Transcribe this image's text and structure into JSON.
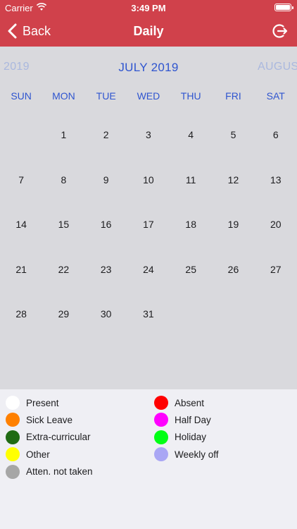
{
  "status_bar": {
    "carrier": "Carrier",
    "time": "3:49 PM",
    "battery_level": 1.0
  },
  "nav": {
    "back_label": "Back",
    "title": "Daily",
    "logout_icon": "logout-icon"
  },
  "calendar": {
    "prev_month": "2019",
    "current_month": "JULY 2019",
    "next_month": "AUGUST",
    "weekdays": [
      "SUN",
      "MON",
      "TUE",
      "WED",
      "THU",
      "FRI",
      "SAT"
    ],
    "days": [
      "",
      "1",
      "2",
      "3",
      "4",
      "5",
      "6",
      "7",
      "8",
      "9",
      "10",
      "11",
      "12",
      "13",
      "14",
      "15",
      "16",
      "17",
      "18",
      "19",
      "20",
      "21",
      "22",
      "23",
      "24",
      "25",
      "26",
      "27",
      "28",
      "29",
      "30",
      "31",
      "",
      "",
      ""
    ]
  },
  "legend": [
    {
      "label": "Present",
      "color": "#ffffff"
    },
    {
      "label": "Absent",
      "color": "#ff0000"
    },
    {
      "label": "Sick Leave",
      "color": "#ff8000"
    },
    {
      "label": "Half Day",
      "color": "#ff00ff"
    },
    {
      "label": "Extra-curricular",
      "color": "#206b14"
    },
    {
      "label": "Holiday",
      "color": "#00ff14"
    },
    {
      "label": "Other",
      "color": "#ffff00"
    },
    {
      "label": "Weekly off",
      "color": "#a9a6f4"
    },
    {
      "label": "Atten. not taken",
      "color": "#a6a6a6"
    }
  ]
}
